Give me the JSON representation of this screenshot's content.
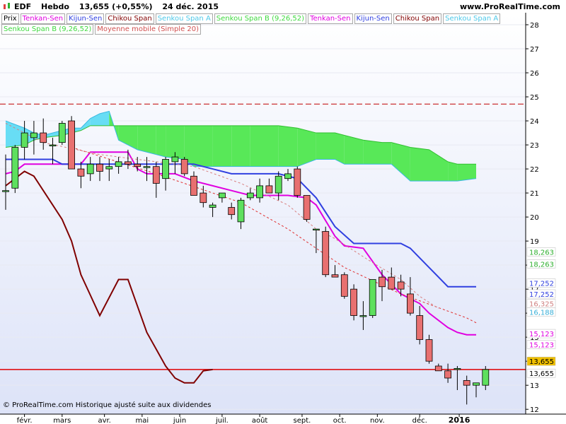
{
  "header": {
    "symbol": "EDF",
    "period": "Hebdo",
    "quote": "13,655 (+0,55%)",
    "date": "24 déc. 2015",
    "site": "www.ProRealTime.com"
  },
  "legend_row1": [
    {
      "label": "Prix",
      "color": "#000000"
    },
    {
      "label": "Tenkan-Sen",
      "color": "#e000e0"
    },
    {
      "label": "Kijun-Sen",
      "color": "#3040e0"
    },
    {
      "label": "Chikou Span",
      "color": "#800000"
    },
    {
      "label": "Senkou Span A",
      "color": "#4ec8e8"
    },
    {
      "label": "Senkou Span B (9,26,52)",
      "color": "#40d840"
    },
    {
      "label": "Tenkan-Sen",
      "color": "#e000e0"
    },
    {
      "label": "Kijun-Sen",
      "color": "#3040e0"
    },
    {
      "label": "Chikou Span",
      "color": "#800000"
    },
    {
      "label": "Senkou Span A",
      "color": "#4ec8e8"
    }
  ],
  "legend_row2": [
    {
      "label": "Senkou Span B (9,26,52)",
      "color": "#40d840"
    },
    {
      "label": "Moyenne mobile (Simple 20)",
      "color": "#d05050"
    }
  ],
  "footer": "© ProRealTime.com  Historique ajusté suite aux dividendes",
  "chart_data": {
    "type": "candlestick",
    "y_axis": {
      "min": 11.8,
      "max": 28.5,
      "position": "right",
      "ticks": [
        12,
        13,
        14,
        15,
        16,
        17,
        18,
        19,
        20,
        21,
        22,
        23,
        24,
        25,
        26,
        27,
        28
      ]
    },
    "x_labels": [
      {
        "label": "févr.",
        "x": 2
      },
      {
        "label": "mars",
        "x": 6
      },
      {
        "label": "avr.",
        "x": 10.5
      },
      {
        "label": "mai",
        "x": 14.5
      },
      {
        "label": "juin",
        "x": 18.5
      },
      {
        "label": "juil.",
        "x": 23
      },
      {
        "label": "août",
        "x": 27
      },
      {
        "label": "sept.",
        "x": 31.5
      },
      {
        "label": "oct.",
        "x": 35.5
      },
      {
        "label": "nov.",
        "x": 39.5
      },
      {
        "label": "déc.",
        "x": 44
      },
      {
        "label": "2016",
        "x": 48.2
      }
    ],
    "candles": [
      {
        "o": 21.1,
        "h": 22.6,
        "l": 20.3,
        "c": 21.1
      },
      {
        "o": 21.2,
        "h": 23.0,
        "l": 21.0,
        "c": 22.9
      },
      {
        "o": 22.9,
        "h": 24.0,
        "l": 22.4,
        "c": 23.5
      },
      {
        "o": 23.3,
        "h": 24.0,
        "l": 22.6,
        "c": 23.5
      },
      {
        "o": 23.5,
        "h": 24.1,
        "l": 22.8,
        "c": 23.1
      },
      {
        "o": 23.0,
        "h": 23.3,
        "l": 22.2,
        "c": 23.0
      },
      {
        "o": 23.1,
        "h": 24.0,
        "l": 23.0,
        "c": 23.9
      },
      {
        "o": 24.0,
        "h": 24.2,
        "l": 22.0,
        "c": 22.0
      },
      {
        "o": 22.0,
        "h": 22.3,
        "l": 21.2,
        "c": 21.7
      },
      {
        "o": 21.8,
        "h": 22.5,
        "l": 21.5,
        "c": 22.2
      },
      {
        "o": 22.2,
        "h": 22.5,
        "l": 21.5,
        "c": 21.9
      },
      {
        "o": 22.0,
        "h": 22.4,
        "l": 21.5,
        "c": 22.1
      },
      {
        "o": 22.1,
        "h": 22.5,
        "l": 21.8,
        "c": 22.3
      },
      {
        "o": 22.3,
        "h": 22.8,
        "l": 22.0,
        "c": 22.2
      },
      {
        "o": 22.2,
        "h": 22.5,
        "l": 21.9,
        "c": 22.1
      },
      {
        "o": 22.1,
        "h": 22.5,
        "l": 21.5,
        "c": 22.1
      },
      {
        "o": 22.1,
        "h": 22.3,
        "l": 20.8,
        "c": 21.4
      },
      {
        "o": 21.6,
        "h": 22.5,
        "l": 21.1,
        "c": 22.4
      },
      {
        "o": 22.3,
        "h": 22.7,
        "l": 21.8,
        "c": 22.5
      },
      {
        "o": 22.4,
        "h": 22.5,
        "l": 21.7,
        "c": 21.8
      },
      {
        "o": 21.7,
        "h": 21.9,
        "l": 20.9,
        "c": 20.9
      },
      {
        "o": 21.0,
        "h": 21.3,
        "l": 20.4,
        "c": 20.6
      },
      {
        "o": 20.4,
        "h": 20.6,
        "l": 20.0,
        "c": 20.5
      },
      {
        "o": 20.8,
        "h": 21.0,
        "l": 20.6,
        "c": 21.0
      },
      {
        "o": 20.4,
        "h": 20.6,
        "l": 19.9,
        "c": 20.1
      },
      {
        "o": 19.8,
        "h": 20.8,
        "l": 19.5,
        "c": 20.7
      },
      {
        "o": 20.8,
        "h": 21.2,
        "l": 20.7,
        "c": 21.0
      },
      {
        "o": 20.8,
        "h": 21.6,
        "l": 20.6,
        "c": 21.3
      },
      {
        "o": 21.3,
        "h": 21.6,
        "l": 21.0,
        "c": 21.0
      },
      {
        "o": 21.0,
        "h": 21.9,
        "l": 20.7,
        "c": 21.7
      },
      {
        "o": 21.6,
        "h": 22.0,
        "l": 21.5,
        "c": 21.8
      },
      {
        "o": 22.0,
        "h": 22.1,
        "l": 20.8,
        "c": 20.9
      },
      {
        "o": 20.9,
        "h": 20.9,
        "l": 19.8,
        "c": 19.9
      },
      {
        "o": 19.5,
        "h": 19.5,
        "l": 18.5,
        "c": 19.5
      },
      {
        "o": 19.4,
        "h": 19.6,
        "l": 17.5,
        "c": 17.6
      },
      {
        "o": 17.6,
        "h": 18.0,
        "l": 17.5,
        "c": 17.5
      },
      {
        "o": 17.6,
        "h": 17.7,
        "l": 16.6,
        "c": 16.7
      },
      {
        "o": 17.0,
        "h": 17.2,
        "l": 15.7,
        "c": 15.9
      },
      {
        "o": 15.9,
        "h": 16.5,
        "l": 15.3,
        "c": 15.9
      },
      {
        "o": 15.9,
        "h": 17.4,
        "l": 15.8,
        "c": 17.4
      },
      {
        "o": 17.5,
        "h": 17.8,
        "l": 16.5,
        "c": 17.1
      },
      {
        "o": 17.5,
        "h": 17.9,
        "l": 17.0,
        "c": 17.0
      },
      {
        "o": 17.3,
        "h": 17.6,
        "l": 16.7,
        "c": 17.0
      },
      {
        "o": 16.8,
        "h": 17.5,
        "l": 15.9,
        "c": 16.0
      },
      {
        "o": 15.9,
        "h": 16.3,
        "l": 14.7,
        "c": 14.9
      },
      {
        "o": 14.9,
        "h": 15.1,
        "l": 13.9,
        "c": 14.0
      },
      {
        "o": 13.8,
        "h": 13.9,
        "l": 13.6,
        "c": 13.6
      },
      {
        "o": 13.6,
        "h": 13.9,
        "l": 13.1,
        "c": 13.3
      },
      {
        "o": 13.7,
        "h": 13.8,
        "l": 12.8,
        "c": 13.7
      },
      {
        "o": 13.2,
        "h": 13.4,
        "l": 12.2,
        "c": 13.0
      },
      {
        "o": 13.0,
        "h": 13.1,
        "l": 12.5,
        "c": 13.1
      },
      {
        "o": 13.0,
        "h": 13.8,
        "l": 12.8,
        "c": 13.655
      }
    ],
    "series": [
      {
        "name": "Tenkan-Sen",
        "color": "#e000e0",
        "points": [
          [
            0,
            21.8
          ],
          [
            1,
            21.9
          ],
          [
            2,
            22.2
          ],
          [
            5,
            22.2
          ],
          [
            6,
            22.2
          ],
          [
            8,
            22.2
          ],
          [
            9,
            22.7
          ],
          [
            11,
            22.7
          ],
          [
            13,
            22.7
          ],
          [
            14,
            22.0
          ],
          [
            15,
            21.8
          ],
          [
            18,
            21.8
          ],
          [
            20,
            21.5
          ],
          [
            22,
            21.3
          ],
          [
            24,
            21.1
          ],
          [
            26,
            20.9
          ],
          [
            28,
            20.9
          ],
          [
            30,
            20.9
          ],
          [
            32,
            20.8
          ],
          [
            33,
            20.5
          ],
          [
            35,
            19.2
          ],
          [
            36,
            18.8
          ],
          [
            38,
            18.7
          ],
          [
            40,
            17.6
          ],
          [
            42,
            16.8
          ],
          [
            44,
            16.4
          ],
          [
            45,
            16.0
          ],
          [
            47,
            15.4
          ],
          [
            48,
            15.2
          ],
          [
            49,
            15.1
          ],
          [
            50,
            15.1
          ]
        ]
      },
      {
        "name": "Kijun-Sen",
        "color": "#3040e0",
        "points": [
          [
            0,
            22.4
          ],
          [
            5,
            22.4
          ],
          [
            6,
            22.2
          ],
          [
            15,
            22.2
          ],
          [
            20,
            22.2
          ],
          [
            22,
            22.0
          ],
          [
            24,
            21.8
          ],
          [
            26,
            21.8
          ],
          [
            29,
            21.8
          ],
          [
            31,
            21.6
          ],
          [
            33,
            20.8
          ],
          [
            35,
            19.6
          ],
          [
            37,
            18.9
          ],
          [
            39,
            18.9
          ],
          [
            40,
            18.9
          ],
          [
            42,
            18.9
          ],
          [
            43,
            18.7
          ],
          [
            45,
            17.9
          ],
          [
            47,
            17.1
          ],
          [
            48,
            17.1
          ],
          [
            50,
            17.1
          ]
        ]
      },
      {
        "name": "Chikou Span",
        "color": "#800000",
        "points": [
          [
            0,
            21.3
          ],
          [
            2,
            21.9
          ],
          [
            3,
            21.7
          ],
          [
            5,
            20.5
          ],
          [
            6,
            19.9
          ],
          [
            7,
            19.0
          ],
          [
            8,
            17.6
          ],
          [
            10,
            15.9
          ],
          [
            12,
            17.4
          ],
          [
            13,
            17.4
          ],
          [
            14,
            16.3
          ],
          [
            15,
            15.2
          ],
          [
            16,
            14.5
          ],
          [
            17,
            13.8
          ],
          [
            18,
            13.3
          ],
          [
            19,
            13.1
          ],
          [
            20,
            13.1
          ],
          [
            21,
            13.6
          ],
          [
            22,
            13.655
          ]
        ]
      },
      {
        "name": "Moyenne mobile (Simple 20)",
        "color": "#e03030",
        "dashed": true,
        "points": [
          [
            7,
            22.9
          ],
          [
            16,
            21.8
          ],
          [
            25,
            20.6
          ],
          [
            30,
            19.5
          ],
          [
            36,
            17.9
          ],
          [
            42,
            16.8
          ],
          [
            49,
            15.8
          ],
          [
            50,
            15.6
          ]
        ]
      },
      {
        "name": "MA2",
        "color": "#d88080",
        "dashed": true,
        "points": [
          [
            0,
            23.9
          ],
          [
            4,
            23.1
          ],
          [
            10,
            22.6
          ],
          [
            20,
            22.1
          ],
          [
            25,
            21.4
          ],
          [
            30,
            20.5
          ],
          [
            33,
            19.5
          ],
          [
            35,
            19.1
          ],
          [
            39,
            18.1
          ],
          [
            42,
            17.4
          ],
          [
            44,
            16.7
          ],
          [
            46,
            16.2
          ]
        ]
      }
    ],
    "cloud": {
      "span_a": [
        [
          0,
          24.0
        ],
        [
          2,
          23.7
        ],
        [
          3,
          23.5
        ],
        [
          4,
          23.4
        ],
        [
          6,
          23.6
        ],
        [
          7,
          23.7
        ],
        [
          8,
          23.7
        ],
        [
          9,
          24.1
        ],
        [
          10,
          24.3
        ],
        [
          11,
          24.4
        ],
        [
          12,
          23.2
        ],
        [
          14,
          22.8
        ],
        [
          16,
          22.6
        ],
        [
          17,
          22.5
        ],
        [
          19,
          22.4
        ],
        [
          20,
          22.1
        ],
        [
          22,
          22.1
        ],
        [
          24,
          22.1
        ],
        [
          26,
          22.1
        ],
        [
          29,
          22.1
        ],
        [
          31,
          22.1
        ],
        [
          33,
          22.4
        ],
        [
          35,
          22.4
        ],
        [
          36,
          22.2
        ],
        [
          38,
          22.2
        ],
        [
          40,
          22.2
        ],
        [
          41,
          22.2
        ],
        [
          43,
          21.5
        ],
        [
          45,
          21.5
        ],
        [
          47,
          21.5
        ],
        [
          48,
          21.5
        ],
        [
          50,
          21.6
        ]
      ],
      "span_b": [
        [
          0,
          22.9
        ],
        [
          2,
          23.0
        ],
        [
          3,
          23.2
        ],
        [
          4,
          23.3
        ],
        [
          6,
          23.4
        ],
        [
          7,
          23.5
        ],
        [
          8,
          23.6
        ],
        [
          9,
          23.8
        ],
        [
          10,
          23.8
        ],
        [
          11,
          23.8
        ],
        [
          12,
          23.8
        ],
        [
          14,
          23.8
        ],
        [
          16,
          23.8
        ],
        [
          17,
          23.8
        ],
        [
          19,
          23.8
        ],
        [
          20,
          23.8
        ],
        [
          22,
          23.8
        ],
        [
          24,
          23.8
        ],
        [
          26,
          23.8
        ],
        [
          29,
          23.8
        ],
        [
          31,
          23.7
        ],
        [
          33,
          23.5
        ],
        [
          35,
          23.5
        ],
        [
          36,
          23.4
        ],
        [
          38,
          23.2
        ],
        [
          40,
          23.1
        ],
        [
          41,
          23.1
        ],
        [
          43,
          22.9
        ],
        [
          45,
          22.8
        ],
        [
          47,
          22.3
        ],
        [
          48,
          22.2
        ],
        [
          50,
          22.2
        ]
      ]
    },
    "h_lines": [
      {
        "name": "resistance",
        "value": 24.7,
        "color": "#c00000",
        "dashed": true
      },
      {
        "name": "last-price",
        "value": 13.655,
        "color": "#e00000",
        "dashed": false
      }
    ],
    "axis_labels": [
      {
        "text": "18,263",
        "value": 18.55,
        "color": "#30b030",
        "bg": "#ffffff"
      },
      {
        "text": "18,263",
        "value": 18.05,
        "color": "#30b030",
        "bg": "#ffffff"
      },
      {
        "text": "17,252",
        "value": 17.25,
        "color": "#3040e0",
        "bg": "#ffffff"
      },
      {
        "text": "17,252",
        "value": 16.8,
        "color": "#3040e0",
        "bg": "#ffffff"
      },
      {
        "text": "16,325",
        "value": 16.4,
        "color": "#d08080",
        "bg": "#ffffff"
      },
      {
        "text": "16,188",
        "value": 16.05,
        "color": "#3ab0d8",
        "bg": "#ffffff"
      },
      {
        "text": "15,123",
        "value": 15.15,
        "color": "#e000e0",
        "bg": "#ffffff"
      },
      {
        "text": "15,123",
        "value": 14.7,
        "color": "#e000e0",
        "bg": "#ffffff"
      },
      {
        "text": "13,655",
        "value": 14.0,
        "color": "#000000",
        "bg": "#f0c000"
      },
      {
        "text": "13,655",
        "value": 13.5,
        "color": "#000000",
        "bg": "#ffffff"
      }
    ]
  }
}
